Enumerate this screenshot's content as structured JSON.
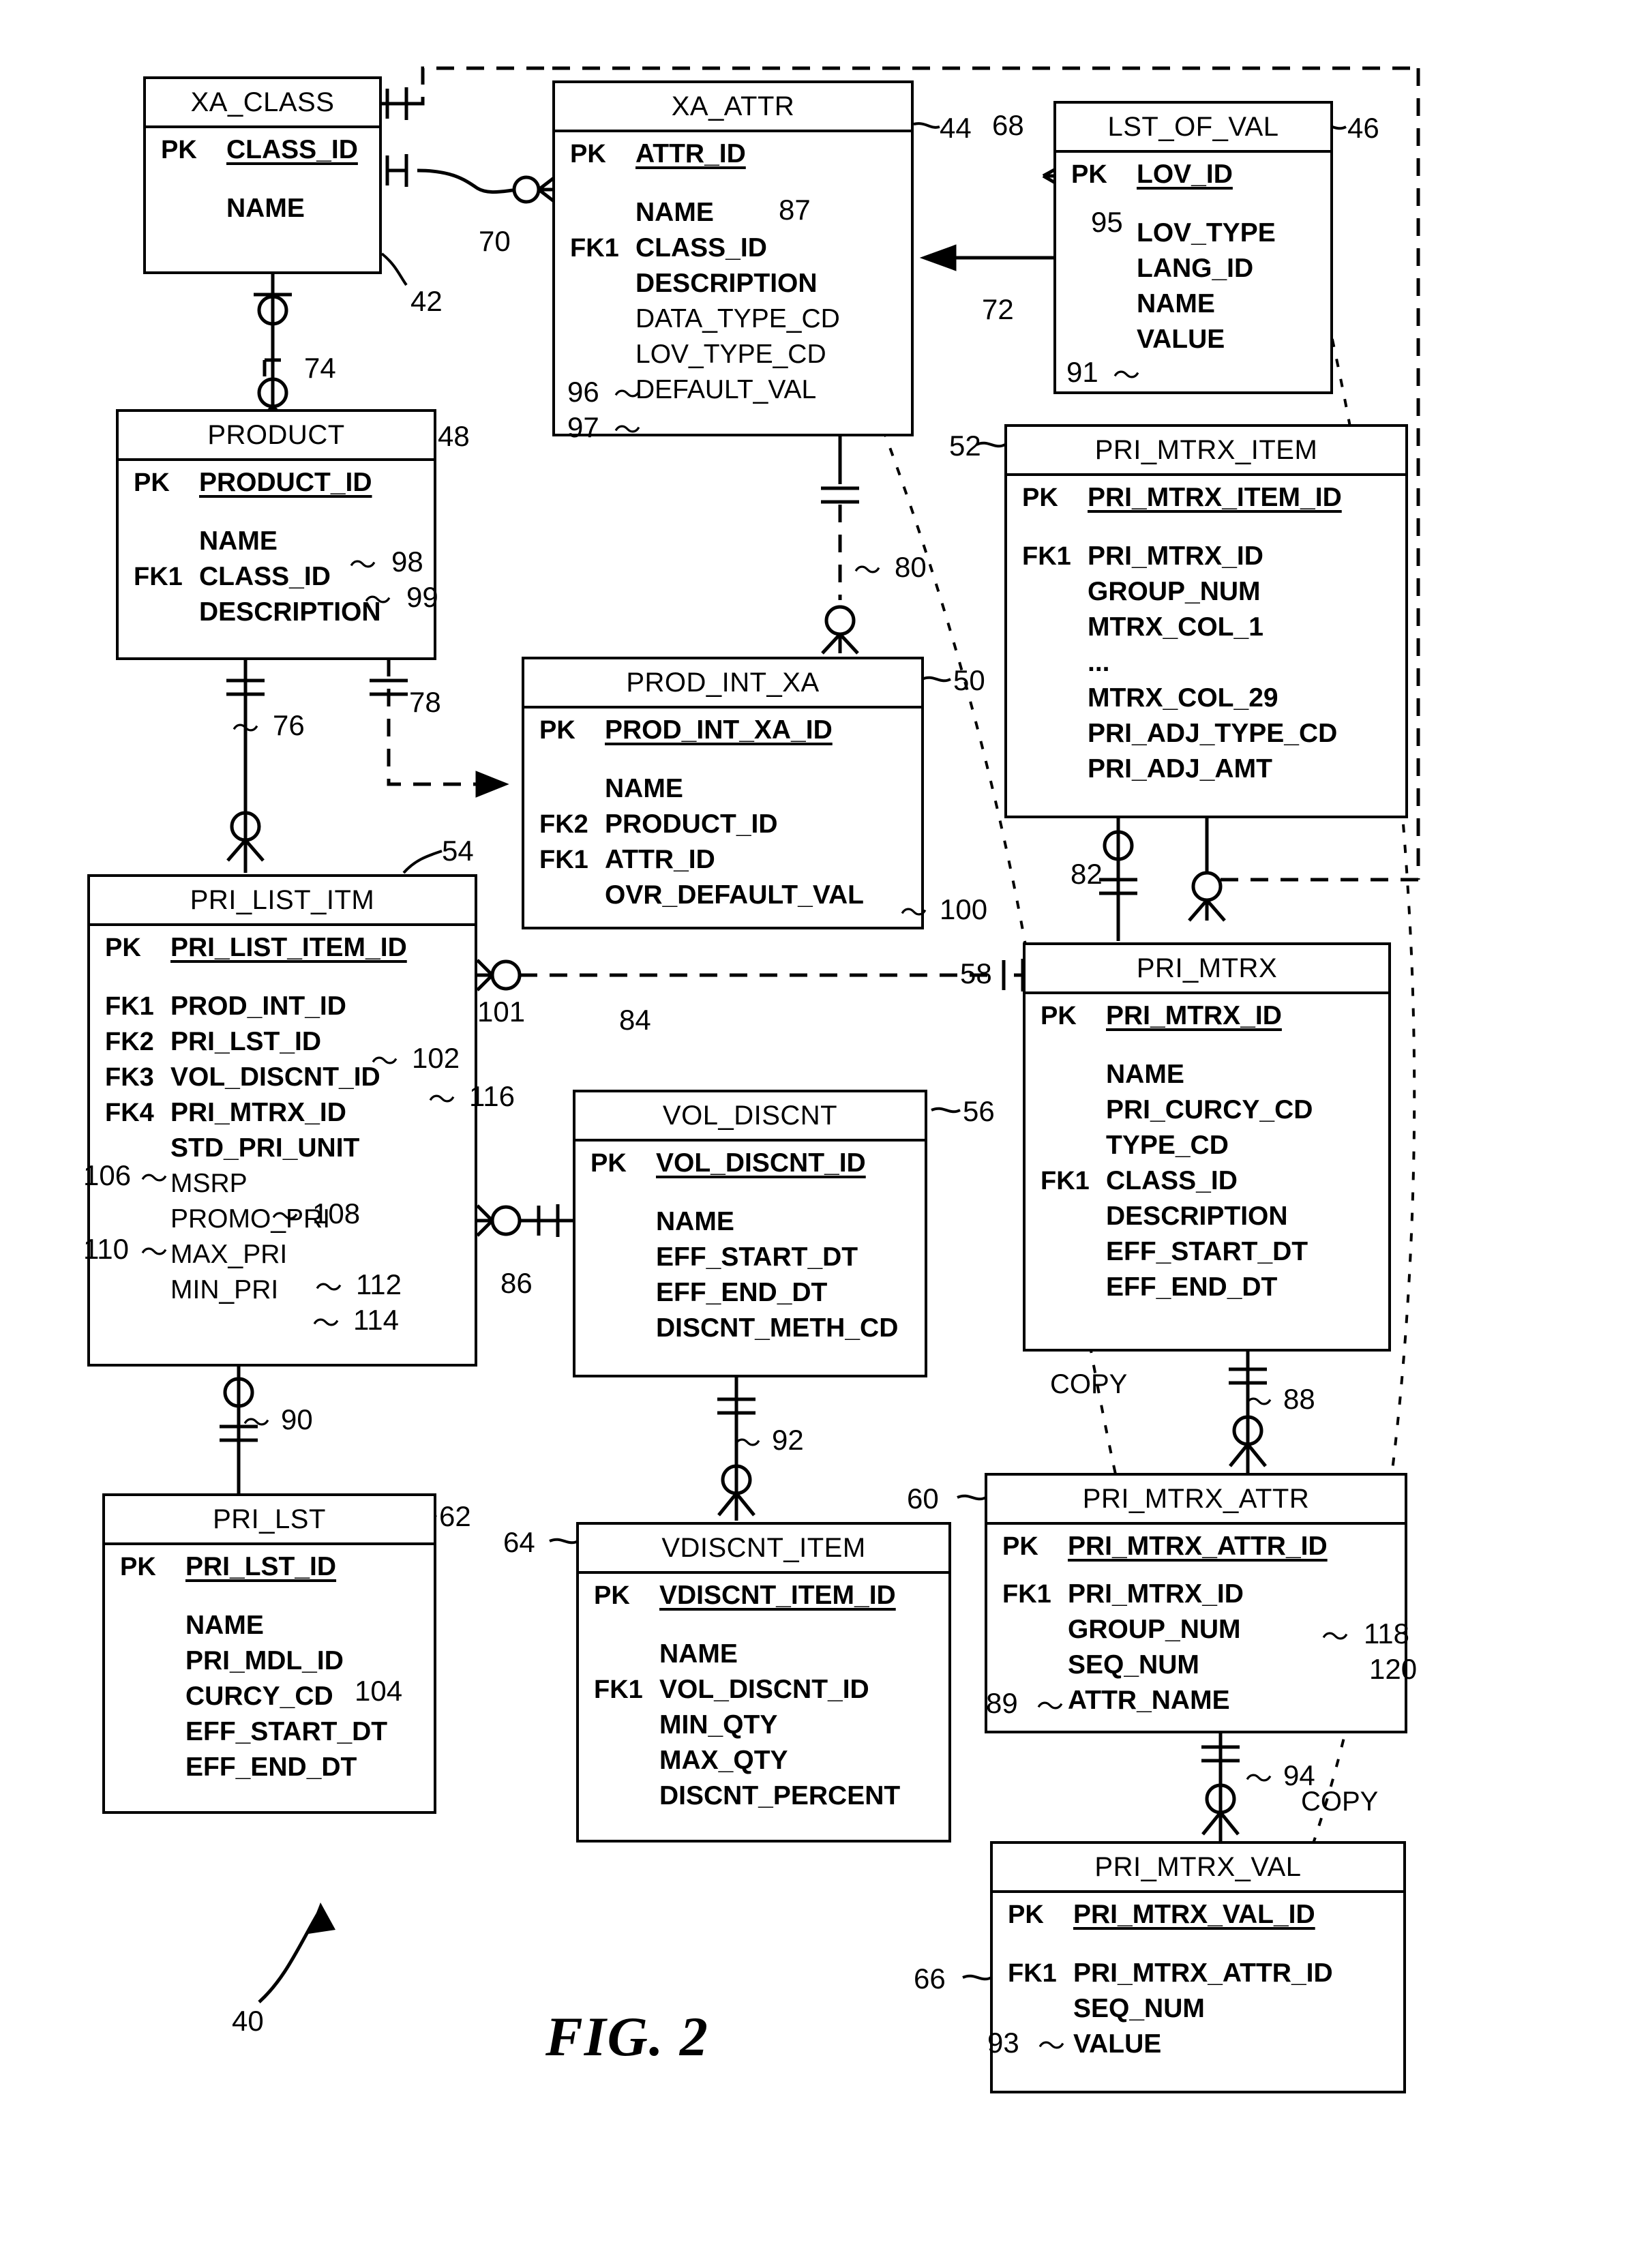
{
  "figure": {
    "label": "FIG. 2",
    "diagram_ref": "40",
    "copy_label_1": "COPY",
    "copy_label_2": "COPY"
  },
  "entities": [
    {
      "id": "xa_class",
      "name": "XA_CLASS",
      "ref": "42",
      "rows": [
        {
          "key": "PK",
          "field": "CLASS_ID",
          "pk": true
        },
        {
          "key": "",
          "field": "NAME",
          "pk": false
        }
      ]
    },
    {
      "id": "xa_attr",
      "name": "XA_ATTR",
      "ref": "44",
      "rows": [
        {
          "key": "PK",
          "field": "ATTR_ID",
          "pk": true
        },
        {
          "key": "",
          "field": "NAME",
          "pk": false
        },
        {
          "key": "FK1",
          "field": "CLASS_ID",
          "pk": false
        },
        {
          "key": "",
          "field": "DESCRIPTION",
          "pk": false
        },
        {
          "key": "",
          "field": "DATA_TYPE_CD",
          "pk": false,
          "light": true
        },
        {
          "key": "",
          "field": "LOV_TYPE_CD",
          "pk": false,
          "light": true,
          "ref": "96"
        },
        {
          "key": "",
          "field": "DEFAULT_VAL",
          "pk": false,
          "light": true,
          "ref": "97"
        }
      ],
      "field_refs": [
        {
          "field": "NAME",
          "ref": "87"
        }
      ]
    },
    {
      "id": "lst_of_val",
      "name": "LST_OF_VAL",
      "ref": "46",
      "rows": [
        {
          "key": "PK",
          "field": "LOV_ID",
          "pk": true
        },
        {
          "key": "",
          "field": "LOV_TYPE",
          "pk": false,
          "ref": "95"
        },
        {
          "key": "",
          "field": "LANG_ID",
          "pk": false
        },
        {
          "key": "",
          "field": "NAME",
          "pk": false
        },
        {
          "key": "",
          "field": "VALUE",
          "pk": false,
          "ref": "91"
        }
      ]
    },
    {
      "id": "product",
      "name": "PRODUCT",
      "ref": "48",
      "rows": [
        {
          "key": "PK",
          "field": "PRODUCT_ID",
          "pk": true
        },
        {
          "key": "",
          "field": "NAME",
          "pk": false,
          "ref": "98"
        },
        {
          "key": "FK1",
          "field": "CLASS_ID",
          "pk": false,
          "ref": "99"
        },
        {
          "key": "",
          "field": "DESCRIPTION",
          "pk": false
        }
      ]
    },
    {
      "id": "pri_mtrx_item",
      "name": "PRI_MTRX_ITEM",
      "ref": "52",
      "rows": [
        {
          "key": "PK",
          "field": "PRI_MTRX_ITEM_ID",
          "pk": true
        },
        {
          "key": "FK1",
          "field": "PRI_MTRX_ID",
          "pk": false
        },
        {
          "key": "",
          "field": "GROUP_NUM",
          "pk": false
        },
        {
          "key": "",
          "field": "MTRX_COL_1",
          "pk": false
        },
        {
          "key": "",
          "field": "...",
          "pk": false
        },
        {
          "key": "",
          "field": "MTRX_COL_29",
          "pk": false
        },
        {
          "key": "",
          "field": "PRI_ADJ_TYPE_CD",
          "pk": false
        },
        {
          "key": "",
          "field": "PRI_ADJ_AMT",
          "pk": false
        }
      ]
    },
    {
      "id": "prod_int_xa",
      "name": "PROD_INT_XA",
      "ref": "50",
      "rows": [
        {
          "key": "PK",
          "field": "PROD_INT_XA_ID",
          "pk": true
        },
        {
          "key": "",
          "field": "NAME",
          "pk": false
        },
        {
          "key": "FK2",
          "field": "PRODUCT_ID",
          "pk": false
        },
        {
          "key": "FK1",
          "field": "ATTR_ID",
          "pk": false
        },
        {
          "key": "",
          "field": "OVR_DEFAULT_VAL",
          "pk": false,
          "ref": "100"
        }
      ]
    },
    {
      "id": "pri_list_itm",
      "name": "PRI_LIST_ITM",
      "ref": "54",
      "rows": [
        {
          "key": "PK",
          "field": "PRI_LIST_ITEM_ID",
          "pk": true
        },
        {
          "key": "FK1",
          "field": "PROD_INT_ID",
          "pk": false
        },
        {
          "key": "FK2",
          "field": "PRI_LST_ID",
          "pk": false,
          "ref": "102"
        },
        {
          "key": "FK3",
          "field": "VOL_DISCNT_ID",
          "pk": false,
          "ref": "116"
        },
        {
          "key": "FK4",
          "field": "PRI_MTRX_ID",
          "pk": false
        },
        {
          "key": "",
          "field": "STD_PRI_UNIT",
          "pk": false,
          "ref": "106",
          "ref_side": "left"
        },
        {
          "key": "",
          "field": "MSRP",
          "pk": false,
          "ref": "108",
          "light": true
        },
        {
          "key": "",
          "field": "PROMO_PRI",
          "pk": false,
          "ref": "110",
          "ref_side": "left",
          "light": true
        },
        {
          "key": "",
          "field": "MAX_PRI",
          "pk": false,
          "ref": "112",
          "light": true
        },
        {
          "key": "",
          "field": "MIN_PRI",
          "pk": false,
          "ref": "114",
          "light": true
        }
      ]
    },
    {
      "id": "pri_mtrx",
      "name": "PRI_MTRX",
      "ref": "58",
      "rows": [
        {
          "key": "PK",
          "field": "PRI_MTRX_ID",
          "pk": true
        },
        {
          "key": "",
          "field": "NAME",
          "pk": false
        },
        {
          "key": "",
          "field": "PRI_CURCY_CD",
          "pk": false
        },
        {
          "key": "",
          "field": "TYPE_CD",
          "pk": false
        },
        {
          "key": "FK1",
          "field": "CLASS_ID",
          "pk": false
        },
        {
          "key": "",
          "field": "DESCRIPTION",
          "pk": false
        },
        {
          "key": "",
          "field": "EFF_START_DT",
          "pk": false
        },
        {
          "key": "",
          "field": "EFF_END_DT",
          "pk": false
        }
      ]
    },
    {
      "id": "vol_discnt",
      "name": "VOL_DISCNT",
      "ref": "56",
      "rows": [
        {
          "key": "PK",
          "field": "VOL_DISCNT_ID",
          "pk": true
        },
        {
          "key": "",
          "field": "NAME",
          "pk": false
        },
        {
          "key": "",
          "field": "EFF_START_DT",
          "pk": false
        },
        {
          "key": "",
          "field": "EFF_END_DT",
          "pk": false
        },
        {
          "key": "",
          "field": "DISCNT_METH_CD",
          "pk": false
        }
      ]
    },
    {
      "id": "pri_lst",
      "name": "PRI_LST",
      "ref": "62",
      "rows": [
        {
          "key": "PK",
          "field": "PRI_LST_ID",
          "pk": true
        },
        {
          "key": "",
          "field": "NAME",
          "pk": false
        },
        {
          "key": "",
          "field": "PRI_MDL_ID",
          "pk": false,
          "ref": "104"
        },
        {
          "key": "",
          "field": "CURCY_CD",
          "pk": false
        },
        {
          "key": "",
          "field": "EFF_START_DT",
          "pk": false
        },
        {
          "key": "",
          "field": "EFF_END_DT",
          "pk": false
        }
      ]
    },
    {
      "id": "vdiscnt_item",
      "name": "VDISCNT_ITEM",
      "ref": "64",
      "rows": [
        {
          "key": "PK",
          "field": "VDISCNT_ITEM_ID",
          "pk": true
        },
        {
          "key": "",
          "field": "NAME",
          "pk": false
        },
        {
          "key": "FK1",
          "field": "VOL_DISCNT_ID",
          "pk": false
        },
        {
          "key": "",
          "field": "MIN_QTY",
          "pk": false
        },
        {
          "key": "",
          "field": "MAX_QTY",
          "pk": false
        },
        {
          "key": "",
          "field": "DISCNT_PERCENT",
          "pk": false
        }
      ]
    },
    {
      "id": "pri_mtrx_attr",
      "name": "PRI_MTRX_ATTR",
      "ref": "60",
      "rows": [
        {
          "key": "PK",
          "field": "PRI_MTRX_ATTR_ID",
          "pk": true
        },
        {
          "key": "FK1",
          "field": "PRI_MTRX_ID",
          "pk": false
        },
        {
          "key": "",
          "field": "GROUP_NUM",
          "pk": false,
          "ref": "118"
        },
        {
          "key": "",
          "field": "SEQ_NUM",
          "pk": false,
          "ref": "120"
        },
        {
          "key": "",
          "field": "ATTR_NAME",
          "pk": false,
          "ref": "89",
          "ref_side": "left"
        }
      ]
    },
    {
      "id": "pri_mtrx_val",
      "name": "PRI_MTRX_VAL",
      "ref": "66",
      "rows": [
        {
          "key": "PK",
          "field": "PRI_MTRX_VAL_ID",
          "pk": true
        },
        {
          "key": "FK1",
          "field": "PRI_MTRX_ATTR_ID",
          "pk": false
        },
        {
          "key": "",
          "field": "SEQ_NUM",
          "pk": false
        },
        {
          "key": "",
          "field": "VALUE",
          "pk": false,
          "ref": "93",
          "ref_side": "left"
        }
      ]
    }
  ],
  "relationship_refs": [
    "68",
    "70",
    "72",
    "74",
    "76",
    "78",
    "80",
    "82",
    "84",
    "86",
    "88",
    "90",
    "92",
    "94",
    "101"
  ],
  "colors": {
    "ink": "#000000",
    "paper": "#ffffff"
  }
}
